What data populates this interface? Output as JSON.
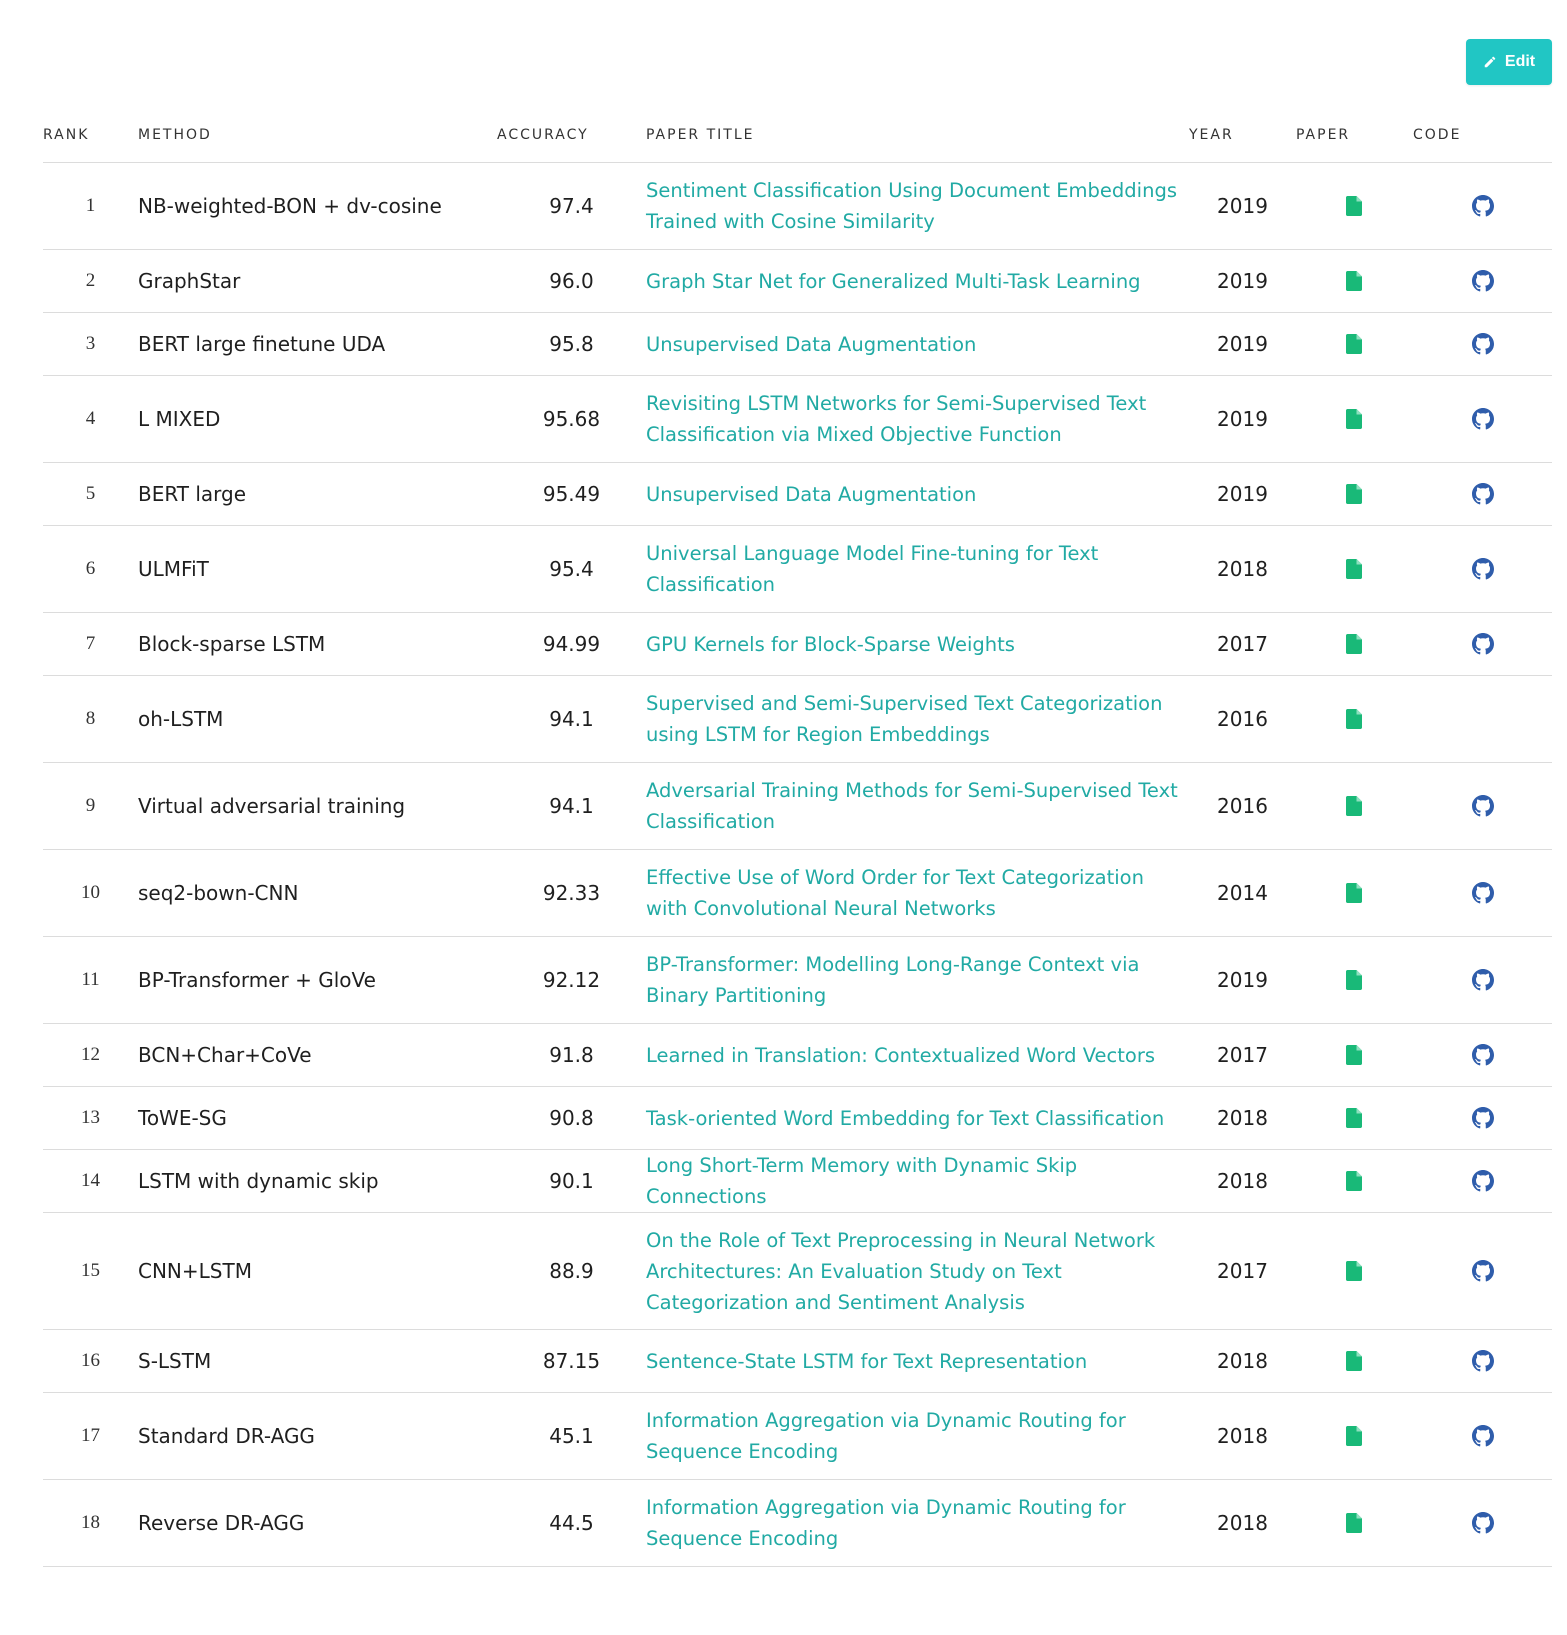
{
  "toolbar": {
    "edit_label": "Edit",
    "edit_icon": "pencil-icon",
    "accent": "#21c6c4"
  },
  "table": {
    "columns": {
      "rank": "RANK",
      "method": "METHOD",
      "accuracy": "ACCURACY",
      "paper_title": "PAPER TITLE",
      "year": "YEAR",
      "paper": "PAPER",
      "code": "CODE"
    },
    "link_color": "#21aaa4",
    "paper_icon_color": "#19b978",
    "code_icon_color": "#2f5dab",
    "rows": [
      {
        "rank": "1",
        "method": "NB-weighted-BON + dv-cosine",
        "accuracy": "97.4",
        "title": "Sentiment Classification Using Document Embeddings Trained with Cosine Similarity",
        "year": "2019",
        "has_code": true
      },
      {
        "rank": "2",
        "method": "GraphStar",
        "accuracy": "96.0",
        "title": "Graph Star Net for Generalized Multi-Task Learning",
        "year": "2019",
        "has_code": true
      },
      {
        "rank": "3",
        "method": "BERT large finetune UDA",
        "accuracy": "95.8",
        "title": "Unsupervised Data Augmentation",
        "year": "2019",
        "has_code": true
      },
      {
        "rank": "4",
        "method": "L MIXED",
        "accuracy": "95.68",
        "title": "Revisiting LSTM Networks for Semi-Supervised Text Classification via Mixed Objective Function",
        "year": "2019",
        "has_code": true
      },
      {
        "rank": "5",
        "method": "BERT large",
        "accuracy": "95.49",
        "title": "Unsupervised Data Augmentation",
        "year": "2019",
        "has_code": true
      },
      {
        "rank": "6",
        "method": "ULMFiT",
        "accuracy": "95.4",
        "title": "Universal Language Model Fine-tuning for Text Classification",
        "year": "2018",
        "has_code": true
      },
      {
        "rank": "7",
        "method": "Block-sparse LSTM",
        "accuracy": "94.99",
        "title": "GPU Kernels for Block-Sparse Weights",
        "year": "2017",
        "has_code": true
      },
      {
        "rank": "8",
        "method": "oh-LSTM",
        "accuracy": "94.1",
        "title": "Supervised and Semi-Supervised Text Categorization using LSTM for Region Embeddings",
        "year": "2016",
        "has_code": false
      },
      {
        "rank": "9",
        "method": "Virtual adversarial training",
        "accuracy": "94.1",
        "title": "Adversarial Training Methods for Semi-Supervised Text Classification",
        "year": "2016",
        "has_code": true
      },
      {
        "rank": "10",
        "method": "seq2-bown-CNN",
        "accuracy": "92.33",
        "title": "Effective Use of Word Order for Text Categorization with Convolutional Neural Networks",
        "year": "2014",
        "has_code": true
      },
      {
        "rank": "11",
        "method": "BP-Transformer + GloVe",
        "accuracy": "92.12",
        "title": "BP-Transformer: Modelling Long-Range Context via Binary Partitioning",
        "year": "2019",
        "has_code": true
      },
      {
        "rank": "12",
        "method": "BCN+Char+CoVe",
        "accuracy": "91.8",
        "title": "Learned in Translation: Contextualized Word Vectors",
        "year": "2017",
        "has_code": true
      },
      {
        "rank": "13",
        "method": "ToWE-SG",
        "accuracy": "90.8",
        "title": "Task-oriented Word Embedding for Text Classification",
        "year": "2018",
        "has_code": true
      },
      {
        "rank": "14",
        "method": "LSTM with dynamic skip",
        "accuracy": "90.1",
        "title": "Long Short-Term Memory with Dynamic Skip Connections",
        "year": "2018",
        "has_code": true
      },
      {
        "rank": "15",
        "method": "CNN+LSTM",
        "accuracy": "88.9",
        "title": "On the Role of Text Preprocessing in Neural Network Architectures: An Evaluation Study on Text Categorization and Sentiment Analysis",
        "year": "2017",
        "has_code": true
      },
      {
        "rank": "16",
        "method": "S-LSTM",
        "accuracy": "87.15",
        "title": "Sentence-State LSTM for Text Representation",
        "year": "2018",
        "has_code": true
      },
      {
        "rank": "17",
        "method": "Standard DR-AGG",
        "accuracy": "45.1",
        "title": "Information Aggregation via Dynamic Routing for Sequence Encoding",
        "year": "2018",
        "has_code": true
      },
      {
        "rank": "18",
        "method": "Reverse DR-AGG",
        "accuracy": "44.5",
        "title": "Information Aggregation via Dynamic Routing for Sequence Encoding",
        "year": "2018",
        "has_code": true
      }
    ]
  }
}
